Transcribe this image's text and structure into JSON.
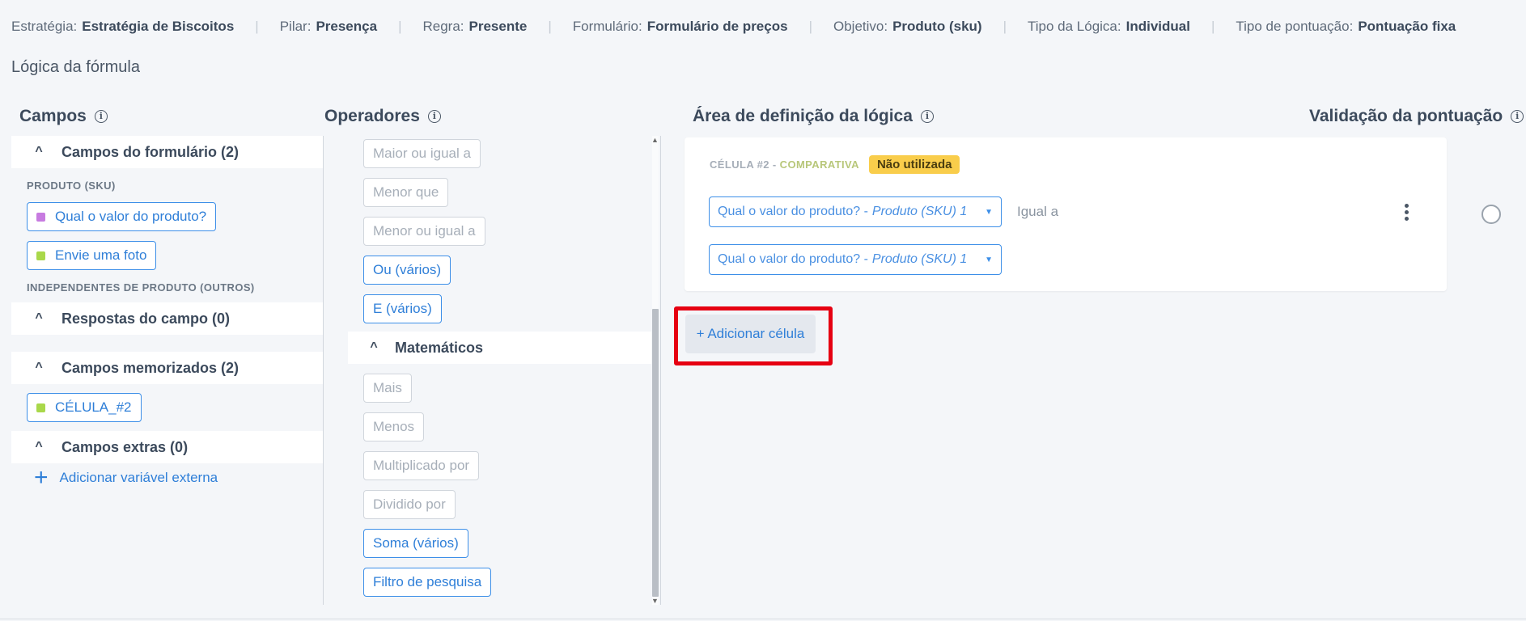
{
  "infobar": [
    {
      "key": "Estratégia:",
      "value": "Estratégia de Biscoitos"
    },
    {
      "key": "Pilar:",
      "value": "Presença"
    },
    {
      "key": "Regra:",
      "value": "Presente"
    },
    {
      "key": "Formulário:",
      "value": "Formulário de preços"
    },
    {
      "key": "Objetivo:",
      "value": "Produto (sku)"
    },
    {
      "key": "Tipo da Lógica:",
      "value": "Individual"
    },
    {
      "key": "Tipo de pontuação:",
      "value": "Pontuação fixa"
    }
  ],
  "page_title": "Lógica da fórmula",
  "headers": {
    "campos": "Campos",
    "operadores": "Operadores",
    "area": "Área de definição da lógica",
    "validacao": "Validação da pontuação",
    "info_glyph": "i"
  },
  "campos": {
    "form_section": "Campos do formulário (2)",
    "produto_label": "PRODUTO (SKU)",
    "form_fields": [
      {
        "label": "Qual o valor do produto?",
        "color": "#c77be0"
      },
      {
        "label": "Envie uma foto",
        "color": "#a9d84a"
      }
    ],
    "independentes_label": "INDEPENDENTES DE PRODUTO (OUTROS)",
    "respostas_section": "Respostas do campo (0)",
    "memorizados_section": "Campos memorizados (2)",
    "memorized_fields": [
      {
        "label": "CÉLULA_#2",
        "color": "#a9d84a"
      }
    ],
    "extras_section": "Campos extras (0)",
    "add_external": "Adicionar variável externa",
    "add_glyph": "+",
    "chevron_glyph": "^"
  },
  "operadores": {
    "comparison_ops": [
      {
        "label": "Maior ou igual a",
        "active": false
      },
      {
        "label": "Menor que",
        "active": false
      },
      {
        "label": "Menor ou igual a",
        "active": false
      },
      {
        "label": "Ou (vários)",
        "active": true
      },
      {
        "label": "E (vários)",
        "active": true
      }
    ],
    "math_section": "Matemáticos",
    "math_ops": [
      {
        "label": "Mais",
        "active": false
      },
      {
        "label": "Menos",
        "active": false
      },
      {
        "label": "Multiplicado por",
        "active": false
      },
      {
        "label": "Dividido por",
        "active": false
      },
      {
        "label": "Soma (vários)",
        "active": true
      },
      {
        "label": "Filtro de pesquisa",
        "active": true
      }
    ]
  },
  "logic": {
    "cell_label": "CÉLULA #2 -",
    "cell_type": "COMPARATIVA",
    "badge": "Não utilizada",
    "select1": {
      "text": "Qual o valor do produto? -",
      "sub": "Produto (SKU) 1"
    },
    "operator": "Igual a",
    "select2": {
      "text": "Qual o valor do produto? -",
      "sub": "Produto (SKU) 1"
    },
    "add_cell": "+ Adicionar célula"
  }
}
